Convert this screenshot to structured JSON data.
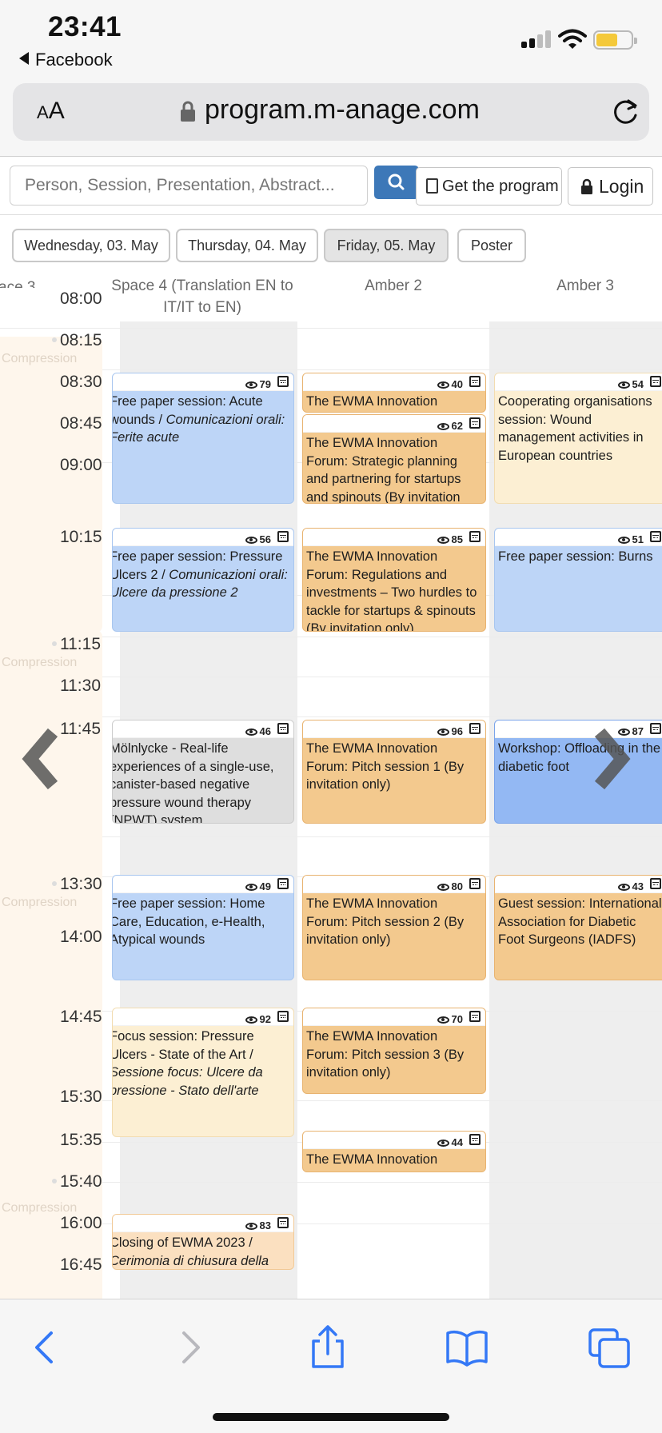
{
  "status": {
    "time": "23:41",
    "back_app": "Facebook"
  },
  "browser": {
    "text_size_label": "AA",
    "url": "program.m-anage.com"
  },
  "toolbar": {
    "search_placeholder": "Person, Session, Presentation, Abstract...",
    "program_label": "Get the program",
    "login_label": "Login",
    "accent": "#3d78b8"
  },
  "days": [
    {
      "label": "Wednesday, 03. May",
      "active": false
    },
    {
      "label": "Thursday, 04. May",
      "active": false
    },
    {
      "label": "Friday, 05. May",
      "active": true
    },
    {
      "label": "Poster",
      "active": false
    }
  ],
  "columns": [
    {
      "label": "ace 3"
    },
    {
      "label": "Space 4 (Translation EN to IT/IT to EN)"
    },
    {
      "label": "Amber 2"
    },
    {
      "label": "Amber 3"
    }
  ],
  "times": [
    "08:00",
    "08:15",
    "08:30",
    "08:45",
    "09:00",
    "10:15",
    "11:15",
    "11:30",
    "11:45",
    "13:30",
    "14:00",
    "14:45",
    "15:30",
    "15:35",
    "15:40",
    "16:00",
    "16:45"
  ],
  "left_column_label": "Compression",
  "events": {
    "s4_1": {
      "views": "79",
      "title": "Free paper session: Acute wounds / ",
      "title_it": "Comunicazioni orali: Ferite acute"
    },
    "s4_2": {
      "views": "56",
      "title": "Free paper session: Pressure Ulcers 2 / ",
      "title_it": "Comunicazioni orali: Ulcere da pressione 2"
    },
    "s4_3": {
      "views": "46",
      "title": "Mölnlycke - Real-life experiences of a single-use, canister-based negative pressure wound therapy (NPWT) system"
    },
    "s4_4": {
      "views": "49",
      "title": "Free paper session: Home Care, Education, e-Health, Atypical wounds"
    },
    "s4_5": {
      "views": "92",
      "title": "Focus session: Pressure Ulcers - State of the Art / ",
      "title_it": "Sessione focus: Ulcere da pressione - Stato dell'arte"
    },
    "s4_6": {
      "views": "83",
      "title": "Closing of EWMA 2023 / ",
      "title_it": "Cerimonia di chiusura della"
    },
    "a2_1": {
      "views": "40",
      "title": "The EWMA Innovation Forum:"
    },
    "a2_2": {
      "views": "62",
      "title": "The EWMA Innovation Forum: Strategic planning and partnering for startups and spinouts (By invitation only)"
    },
    "a2_3": {
      "views": "85",
      "title": "The EWMA Innovation Forum: Regulations and investments – Two hurdles to tackle for startups & spinouts (By invitation only)"
    },
    "a2_4": {
      "views": "96",
      "title": "The EWMA Innovation Forum: Pitch session 1 (By invitation only)"
    },
    "a2_5": {
      "views": "80",
      "title": "The EWMA Innovation Forum: Pitch session 2 (By invitation only)"
    },
    "a2_6": {
      "views": "70",
      "title": "The EWMA Innovation Forum: Pitch session 3 (By invitation only)"
    },
    "a2_7": {
      "views": "44",
      "title": "The EWMA Innovation Forum:"
    },
    "a3_1": {
      "views": "54",
      "title": "Cooperating organisations session: Wound management activities in European countries"
    },
    "a3_2": {
      "views": "51",
      "title": "Free paper session: Burns"
    },
    "a3_3": {
      "views": "87",
      "title": "Workshop: Offloading in the diabetic foot"
    },
    "a3_4": {
      "views": "43",
      "title": "Guest session: International Association for Diabetic Foot Surgeons (IADFS)"
    }
  }
}
